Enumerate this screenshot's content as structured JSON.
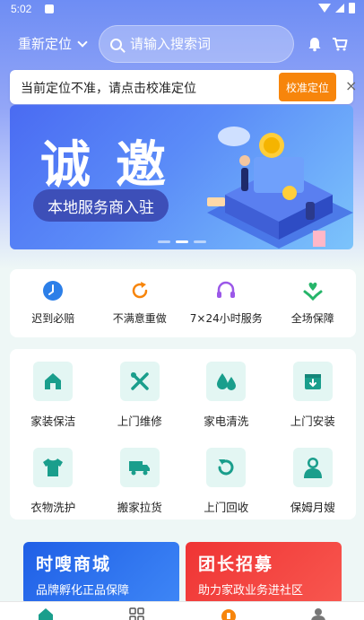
{
  "status_bar": {
    "time": "5:02"
  },
  "header": {
    "location_label": "重新定位",
    "search_placeholder": "请输入搜索词"
  },
  "notice": {
    "text": "当前定位不准，请点击校准定位",
    "button_label": "校准定位",
    "close_glyph": "×"
  },
  "banner": {
    "headline": "诚邀",
    "subtitle": "本地服务商入驻"
  },
  "features": [
    {
      "label": "迟到必赔",
      "icon": "clock-icon",
      "color": "#2c7fe8"
    },
    {
      "label": "不满意重做",
      "icon": "refresh-icon",
      "color": "#f7850b"
    },
    {
      "label": "7×24小时服务",
      "icon": "headset-icon",
      "color": "#9b58e8"
    },
    {
      "label": "全场保障",
      "icon": "heart-hands-icon",
      "color": "#26b56a"
    }
  ],
  "services": [
    {
      "label": "家装保洁",
      "icon": "house-icon"
    },
    {
      "label": "上门维修",
      "icon": "tools-icon"
    },
    {
      "label": "家电清洗",
      "icon": "water-drops-icon"
    },
    {
      "label": "上门安装",
      "icon": "box-icon"
    },
    {
      "label": "衣物洗护",
      "icon": "tshirt-icon"
    },
    {
      "label": "搬家拉货",
      "icon": "truck-icon"
    },
    {
      "label": "上门回收",
      "icon": "recycle-icon"
    },
    {
      "label": "保姆月嫂",
      "icon": "nanny-icon"
    }
  ],
  "promos": [
    {
      "title": "时嗖商城",
      "subtitle": "品牌孵化正品保障",
      "color": "#1f5fe6"
    },
    {
      "title": "团长招募",
      "subtitle": "助力家政业务进社区",
      "color": "#ef3434"
    }
  ],
  "tabbar": {
    "icons": [
      "home-icon",
      "grid-icon",
      "orders-icon",
      "profile-icon"
    ]
  },
  "colors": {
    "accent": "#f7850b",
    "teal": "#1a9e8c",
    "teal_bg": "#e3f6f3"
  }
}
